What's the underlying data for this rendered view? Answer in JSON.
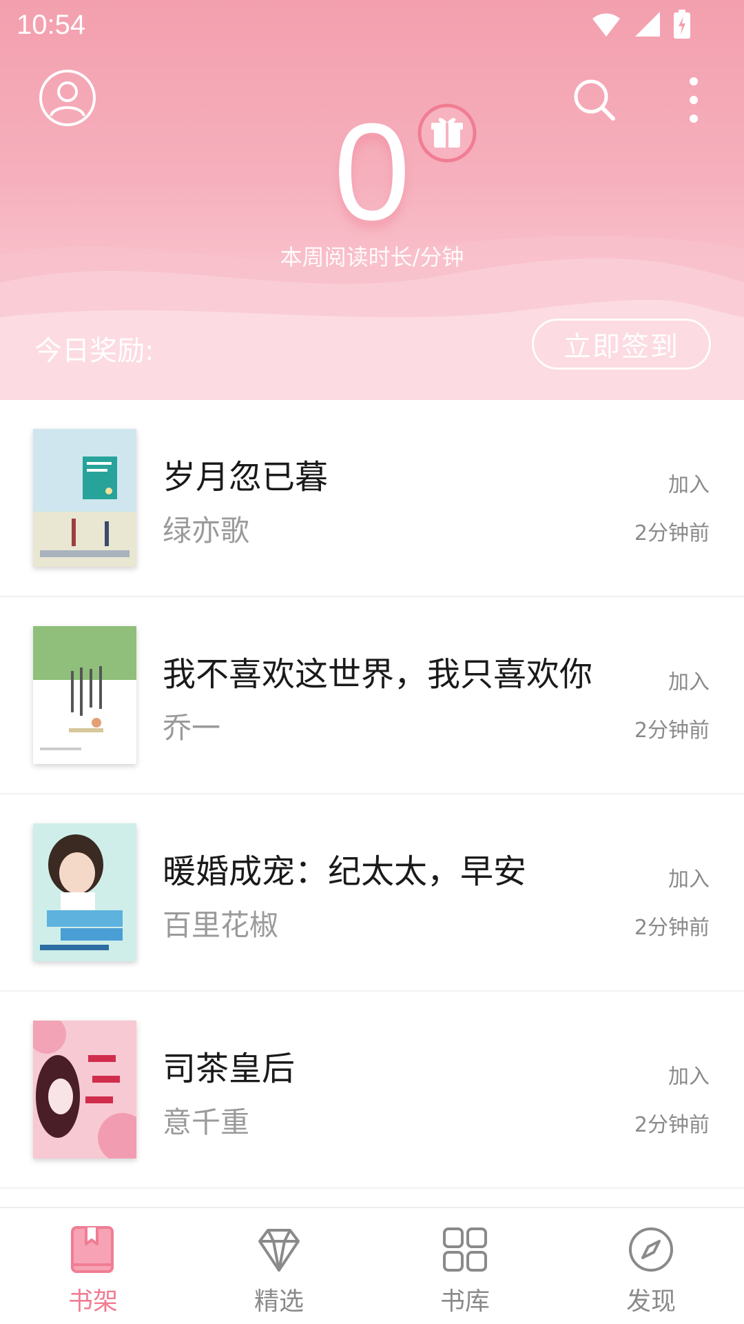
{
  "status_bar": {
    "time": "10:54"
  },
  "header": {
    "week_minutes": "0",
    "week_label": "本周阅读时长/分钟",
    "reward_label": "今日奖励:",
    "signin_button": "立即签到",
    "accent_color": "#f39fae"
  },
  "books": [
    {
      "title": "岁月忽已暮",
      "author": "绿亦歌",
      "status": "加入",
      "time": "2分钟前"
    },
    {
      "title": "我不喜欢这世界，我只喜欢你",
      "author": "乔一",
      "status": "加入",
      "time": "2分钟前"
    },
    {
      "title": "暖婚成宠：纪太太，早安",
      "author": "百里花椒",
      "status": "加入",
      "time": "2分钟前"
    },
    {
      "title": "司茶皇后",
      "author": "意千重",
      "status": "加入",
      "time": "2分钟前"
    }
  ],
  "bottom_nav": {
    "items": [
      {
        "label": "书架",
        "icon": "bookmark-book-icon",
        "active": true
      },
      {
        "label": "精选",
        "icon": "diamond-icon",
        "active": false
      },
      {
        "label": "书库",
        "icon": "grid-icon",
        "active": false
      },
      {
        "label": "发现",
        "icon": "compass-icon",
        "active": false
      }
    ],
    "active_color": "#f07d93"
  }
}
